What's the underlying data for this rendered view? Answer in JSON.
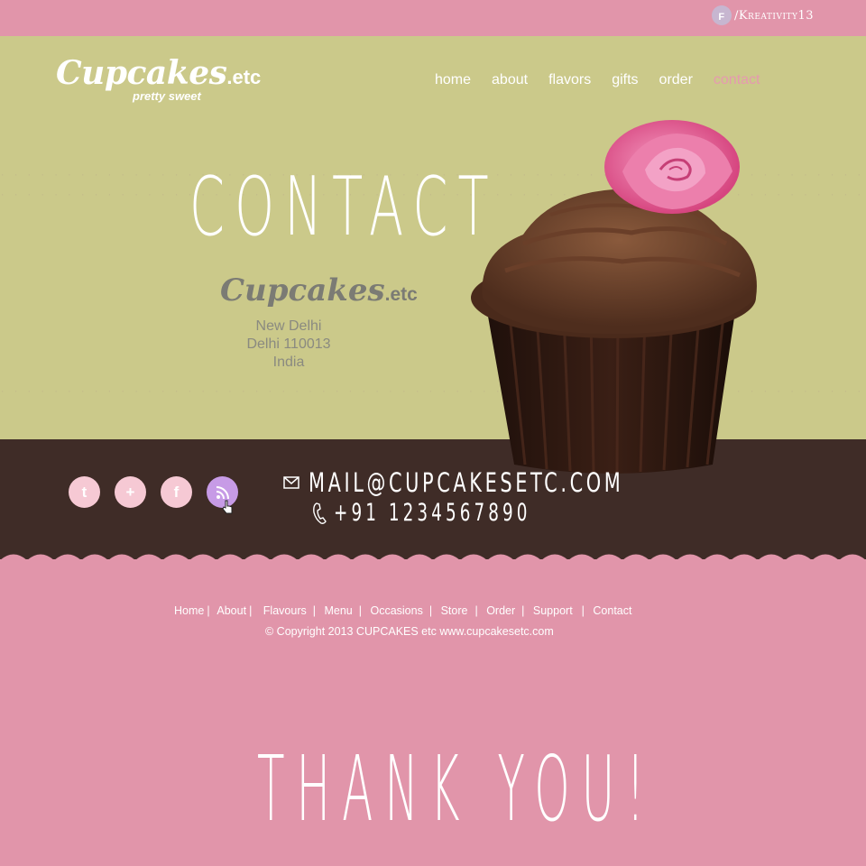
{
  "social_top": {
    "label": "/Kreativity13",
    "icon": "facebook-icon"
  },
  "logo": {
    "name": "Cupcakes",
    "suffix": ".etc",
    "tagline": "pretty sweet"
  },
  "nav": [
    {
      "label": "home"
    },
    {
      "label": "about"
    },
    {
      "label": "flavors"
    },
    {
      "label": "gifts"
    },
    {
      "label": "order"
    },
    {
      "label": "contact",
      "active": true
    }
  ],
  "hero": {
    "title": "CONTACT",
    "company_name": "Cupcakes",
    "company_suffix": ".etc",
    "address": [
      "New Delhi",
      "Delhi 110013",
      "India"
    ]
  },
  "contact": {
    "email": "MAIL@CUPCAKESETC.COM",
    "phone": "+91 1234567890"
  },
  "social_buttons": [
    {
      "icon": "twitter-icon",
      "glyph": "t"
    },
    {
      "icon": "google-plus-icon",
      "glyph": "+"
    },
    {
      "icon": "facebook-icon",
      "glyph": "f"
    },
    {
      "icon": "rss-icon",
      "glyph": ""
    }
  ],
  "footer": {
    "links": [
      "Home",
      "About",
      "Flavours",
      "Menu",
      "Occasions",
      "Store",
      "Order",
      "Support",
      "Contact"
    ],
    "copyright": "© Copyright 2013  CUPCAKES etc  www.cupcakesetc.com"
  },
  "thanks": "THANK YOU!",
  "colors": {
    "pink": "#e195aa",
    "olive": "#cbc98a",
    "brown": "#3f2c27",
    "nav_active": "#e699b0",
    "rss": "#c79be6"
  }
}
